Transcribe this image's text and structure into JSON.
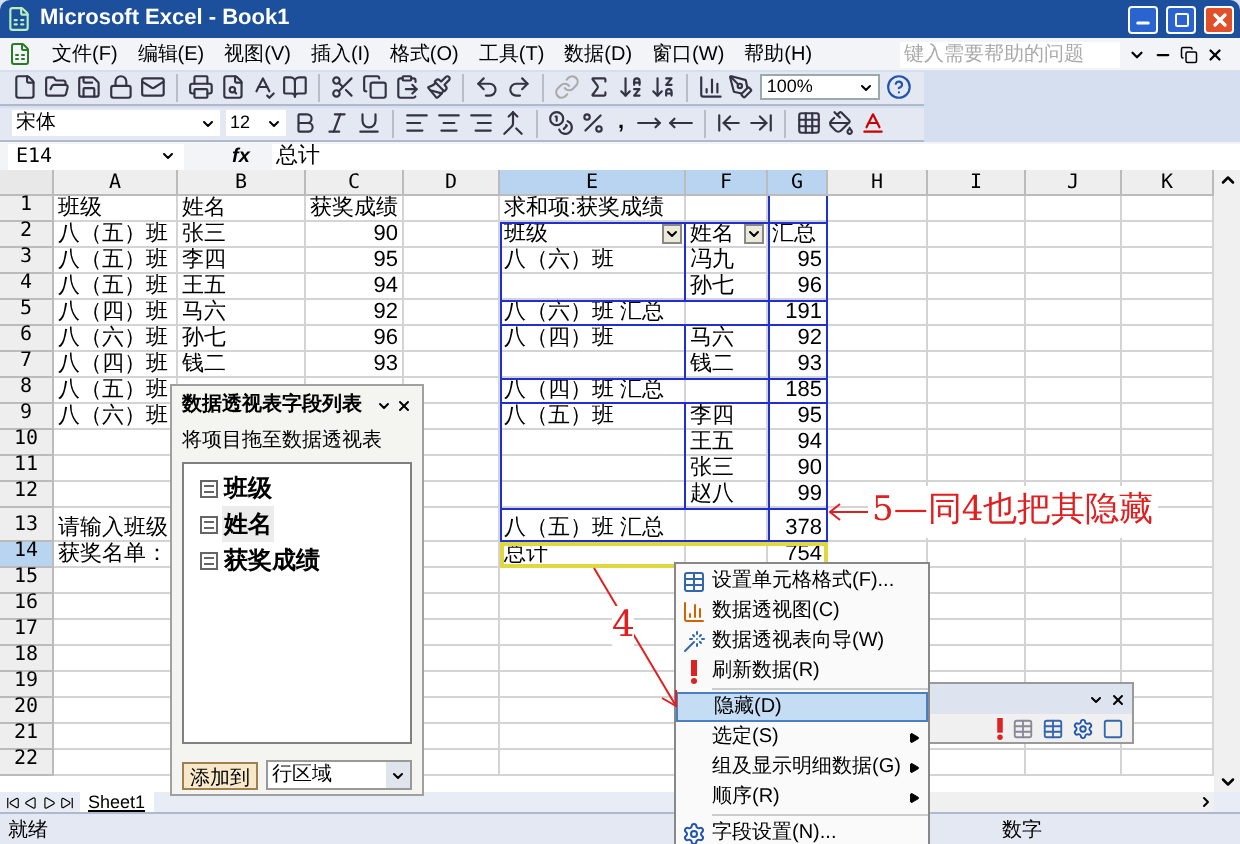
{
  "window": {
    "title": "Microsoft Excel - Book1"
  },
  "menu_bar": {
    "items": [
      "文件(F)",
      "编辑(E)",
      "视图(V)",
      "插入(I)",
      "格式(O)",
      "工具(T)",
      "数据(D)",
      "窗口(W)",
      "帮助(H)"
    ],
    "help_placeholder": "键入需要帮助的问题"
  },
  "standard_toolbar": {
    "zoom": "100%"
  },
  "formatting_toolbar": {
    "font": "宋体",
    "size": "12",
    "comma_style": ","
  },
  "formula_bar": {
    "name_box": "E14",
    "function_label": "fx",
    "value": "总计"
  },
  "sheet": {
    "columns": [
      {
        "label": "A",
        "selected": false
      },
      {
        "label": "B",
        "selected": false
      },
      {
        "label": "C",
        "selected": false
      },
      {
        "label": "D",
        "selected": false
      },
      {
        "label": "E",
        "selected": true
      },
      {
        "label": "F",
        "selected": true
      },
      {
        "label": "G",
        "selected": true
      },
      {
        "label": "H",
        "selected": false
      },
      {
        "label": "I",
        "selected": false
      },
      {
        "label": "J",
        "selected": false
      },
      {
        "label": "K",
        "selected": false
      }
    ],
    "rows": [
      {
        "label": "1",
        "selected": false,
        "cells": {
          "a": "班级",
          "b": "姓名",
          "c": "获奖成绩",
          "e": "求和项:获奖成绩"
        }
      },
      {
        "label": "2",
        "selected": false,
        "cells": {
          "a": "八（五）班",
          "b": "张三",
          "c": {
            "text": "90",
            "kind": "number"
          },
          "e": {
            "text": "班级",
            "kind": "field"
          },
          "f": {
            "text": "姓名",
            "kind": "field"
          },
          "g": "汇总"
        }
      },
      {
        "label": "3",
        "selected": false,
        "cells": {
          "a": "八（五）班",
          "b": "李四",
          "c": {
            "text": "95",
            "kind": "number"
          },
          "e": "八（六）班",
          "f": "冯九",
          "g": {
            "text": "95",
            "kind": "number"
          }
        }
      },
      {
        "label": "4",
        "selected": false,
        "cells": {
          "a": "八（五）班",
          "b": "王五",
          "c": {
            "text": "94",
            "kind": "number"
          },
          "f": "孙七",
          "g": {
            "text": "96",
            "kind": "number"
          }
        }
      },
      {
        "label": "5",
        "selected": false,
        "cells": {
          "a": "八（四）班",
          "b": "马六",
          "c": {
            "text": "92",
            "kind": "number"
          },
          "e": "八（六）班 汇总",
          "g": {
            "text": "191",
            "kind": "number"
          }
        }
      },
      {
        "label": "6",
        "selected": false,
        "cells": {
          "a": "八（六）班",
          "b": "孙七",
          "c": {
            "text": "96",
            "kind": "number"
          },
          "e": "八（四）班",
          "f": "马六",
          "g": {
            "text": "92",
            "kind": "number"
          }
        }
      },
      {
        "label": "7",
        "selected": false,
        "cells": {
          "a": "八（四）班",
          "b": "钱二",
          "c": {
            "text": "93",
            "kind": "number"
          },
          "f": "钱二",
          "g": {
            "text": "93",
            "kind": "number"
          }
        }
      },
      {
        "label": "8",
        "selected": false,
        "cells": {
          "a": "八（五）班",
          "e": "八（四）班 汇总",
          "g": {
            "text": "185",
            "kind": "number"
          }
        }
      },
      {
        "label": "9",
        "selected": false,
        "cells": {
          "a": "八（六）班",
          "e": "八（五）班",
          "f": "李四",
          "g": {
            "text": "95",
            "kind": "number"
          }
        }
      },
      {
        "label": "10",
        "selected": false,
        "cells": {
          "f": "王五",
          "g": {
            "text": "94",
            "kind": "number"
          }
        }
      },
      {
        "label": "11",
        "selected": false,
        "cells": {
          "f": "张三",
          "g": {
            "text": "90",
            "kind": "number"
          }
        }
      },
      {
        "label": "12",
        "selected": false,
        "cells": {
          "f": "赵八",
          "g": {
            "text": "99",
            "kind": "number"
          }
        }
      },
      {
        "label": "13",
        "selected": false,
        "cells": {
          "a": "请输入班级",
          "e": "八（五）班 汇总",
          "g": {
            "text": "378",
            "kind": "number"
          }
        }
      },
      {
        "label": "14",
        "selected": true,
        "cells": {
          "a": "获奖名单：",
          "e": "总计",
          "g": {
            "text": "754",
            "kind": "number"
          }
        }
      },
      {
        "label": "15",
        "selected": false,
        "cells": {}
      },
      {
        "label": "16",
        "selected": false,
        "cells": {}
      },
      {
        "label": "17",
        "selected": false,
        "cells": {}
      },
      {
        "label": "18",
        "selected": false,
        "cells": {}
      },
      {
        "label": "19",
        "selected": false,
        "cells": {}
      },
      {
        "label": "20",
        "selected": false,
        "cells": {}
      },
      {
        "label": "21",
        "selected": false,
        "cells": {}
      },
      {
        "label": "22",
        "selected": false,
        "cells": {}
      }
    ]
  },
  "sheet_tabs": [
    {
      "label": "Sheet1",
      "selected": true
    }
  ],
  "status_bar": {
    "status": "就绪",
    "mode": "数字"
  },
  "pivot_field_list": {
    "title": "数据透视表字段列表",
    "hint": "将项目拖至数据透视表",
    "fields": [
      {
        "label": "班级",
        "selected": false
      },
      {
        "label": "姓名",
        "selected": true
      },
      {
        "label": "获奖成绩",
        "selected": false
      }
    ],
    "add_button": "添加到",
    "area": "行区域"
  },
  "context_menu": {
    "items": [
      {
        "kind": "item",
        "label": "设置单元格格式(F)...",
        "selected": false,
        "submenu": false
      },
      {
        "kind": "item",
        "label": "数据透视图(C)",
        "selected": false,
        "submenu": false
      },
      {
        "kind": "item",
        "label": "数据透视表向导(W)",
        "selected": false,
        "submenu": false
      },
      {
        "kind": "item",
        "label": "刷新数据(R)",
        "selected": false,
        "submenu": false
      },
      {
        "kind": "separator"
      },
      {
        "kind": "item",
        "label": "隐藏(D)",
        "selected": true,
        "submenu": false
      },
      {
        "kind": "item",
        "label": "选定(S)",
        "selected": false,
        "submenu": true
      },
      {
        "kind": "item",
        "label": "组及显示明细数据(G)",
        "selected": false,
        "submenu": true
      },
      {
        "kind": "item",
        "label": "顺序(R)",
        "selected": false,
        "submenu": true
      },
      {
        "kind": "separator"
      },
      {
        "kind": "item",
        "label": "字段设置(N)...",
        "selected": false,
        "submenu": false
      }
    ]
  },
  "annotations": [
    {
      "kind": "right",
      "label": "5—同4也把其隐藏"
    },
    {
      "kind": "down",
      "label": "4"
    }
  ]
}
